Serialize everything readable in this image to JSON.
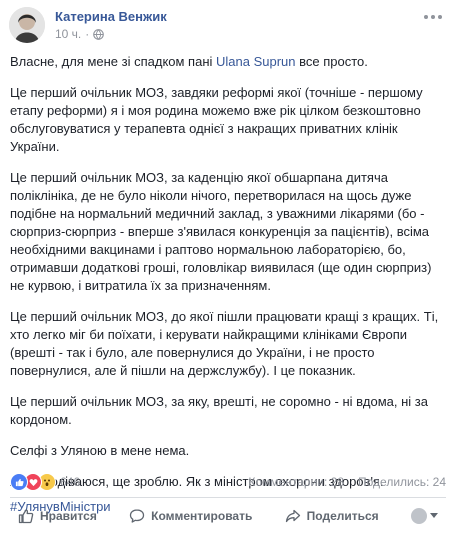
{
  "header": {
    "author": "Катерина Венжик",
    "time": "10 ч.",
    "separator": "·"
  },
  "post": {
    "p1_prefix": "Власне, для мене зі спадком пані ",
    "p1_link": "Ulana Suprun",
    "p1_suffix": " все просто.",
    "p2": "Це перший очільник МОЗ, завдяки реформі якої (точніше - першому етапу реформи) я і моя родина можемо вже рік цілком безкоштовно обслуговуватися у терапевта однієї з накращих приватних клінік України.",
    "p3": "Це перший очільник МОЗ, за каденцію якої обшарпана дитяча поліклініка, де не було ніколи нічого, перетворилася на щось дуже подібне на нормальний медичний заклад, з уважними лікарями (бо - сюрприз-сюрприз - вперше з'явилася конкуренція за пацієнтів), всіма необхідними вакцинами і раптово нормальною лабораторією, бо, отримавши додаткові гроші, головлікар виявилася (ще один сюрприз) не курвою, і витратила їх за призначенням.",
    "p4": "Це перший очільник МОЗ, до якої пішли працювати кращі з кращих. Ті, хто легко міг би поїхати, і керувати найкращими клініками Європи (врешті - так і було, але повернулися до України, і не просто повернулися, але й пішли на держслужбу). І це показник.",
    "p5": "Це перший очільник МОЗ, за яку, врешті, не соромно - ні вдома, ні за кордоном.",
    "p6": "Селфі з Уляною в мене нема.",
    "p7": "Але сподіваюся, ще зроблю. Як з міністром охорони здоров'я.",
    "hashtag": "#УлянувМіністри"
  },
  "stats": {
    "reaction_count": "646",
    "comments": "Комментарии: 28",
    "shares": "Поделились: 24"
  },
  "actions": {
    "like": "Нравится",
    "comment": "Комментировать",
    "share": "Поделиться"
  },
  "icons": [
    "globe-icon",
    "more-icon",
    "like-reaction-icon",
    "love-reaction-icon",
    "wow-reaction-icon",
    "thumbs-up-icon",
    "comment-icon",
    "share-icon"
  ],
  "colors": {
    "link": "#385898",
    "meta": "#90949c",
    "text": "#1d2129",
    "like": "#4a7df5",
    "love": "#f0445b",
    "wow": "#f7c94a"
  }
}
